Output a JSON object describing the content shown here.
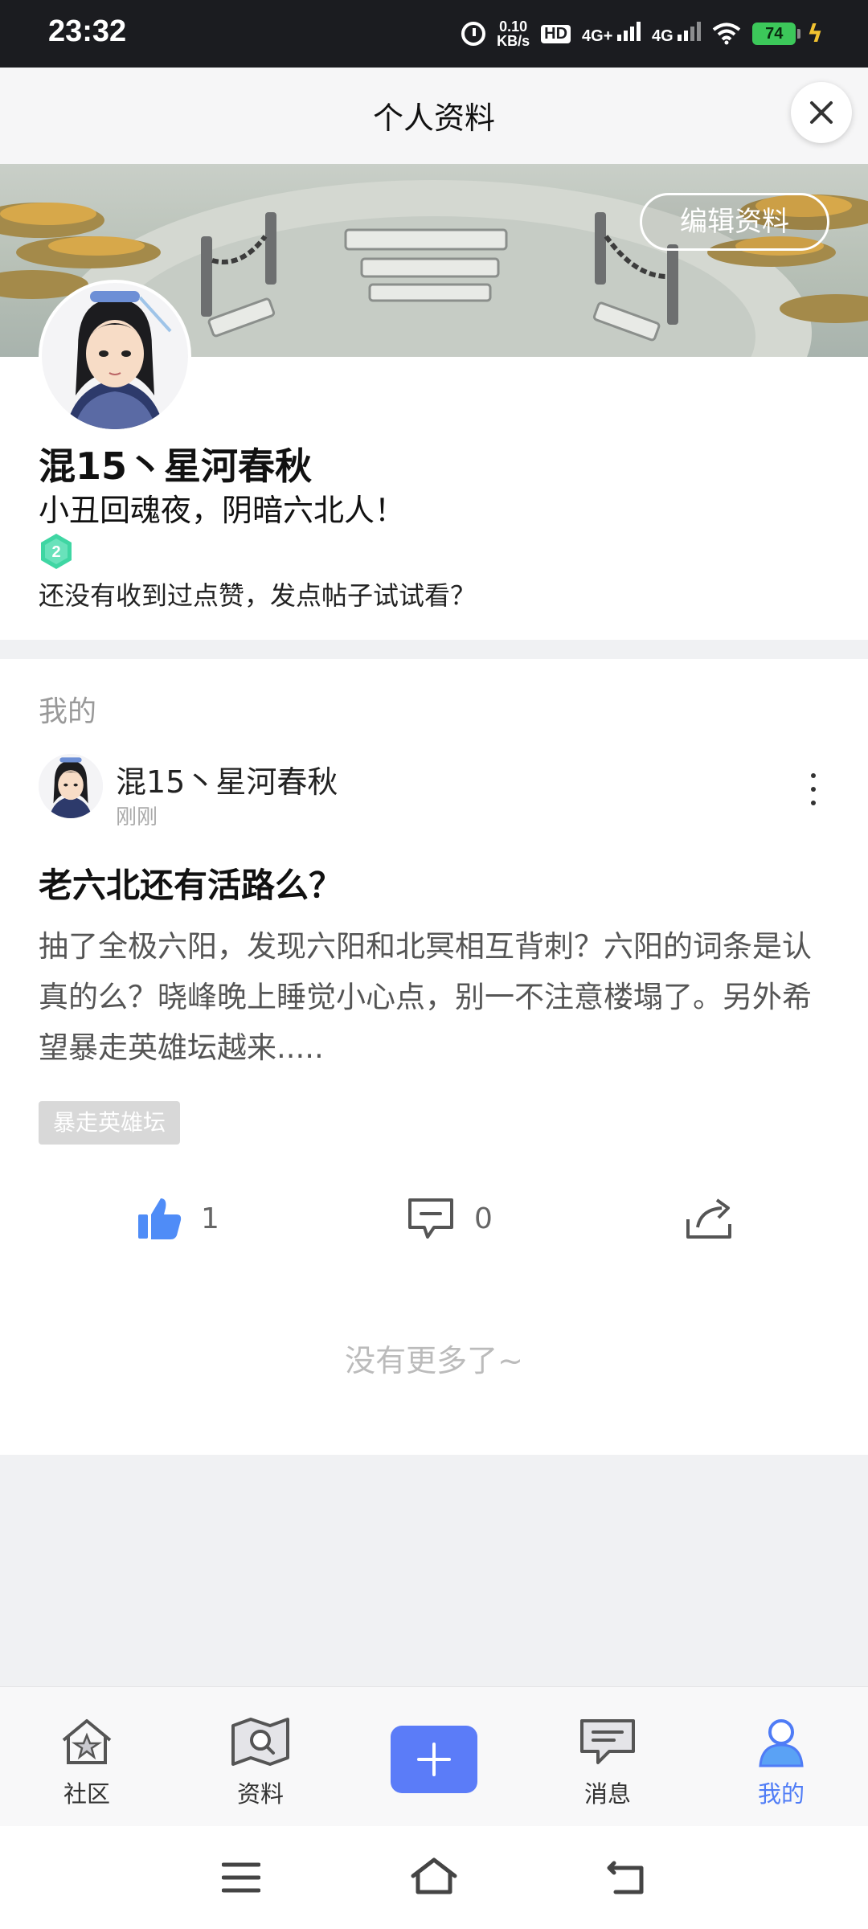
{
  "status_bar": {
    "time": "23:32",
    "net_speed_value": "0.10",
    "net_speed_unit": "KB/s",
    "hd_label": "HD",
    "signal1_label": "4G+",
    "signal2_label": "4G",
    "battery_level": "74"
  },
  "header": {
    "title": "个人资料"
  },
  "banner": {
    "edit_label": "编辑资料"
  },
  "profile": {
    "nickname": "混15丶星河春秋",
    "signature": "小丑回魂夜，阴暗六北人！",
    "level": "2",
    "no_likes_text": "还没有收到过点赞，发点帖子试试看？"
  },
  "section": {
    "label": "我的",
    "post": {
      "author": "混15丶星河春秋",
      "time": "刚刚",
      "title": "老六北还有活路么？",
      "body": "抽了全极六阳，发现六阳和北冥相互背刺？六阳的词条是认真的么？晓峰晚上睡觉小心点，别一不注意楼塌了。另外希望暴走英雄坛越来.....",
      "tag": "暴走英雄坛",
      "likes": "1",
      "comments": "0"
    },
    "no_more": "没有更多了~"
  },
  "bottom_nav": {
    "items": [
      {
        "label": "社区",
        "icon": "community-icon"
      },
      {
        "label": "资料",
        "icon": "wiki-icon"
      },
      {
        "label": "消息",
        "icon": "message-icon"
      },
      {
        "label": "我的",
        "icon": "profile-icon"
      }
    ],
    "active_index": 3
  },
  "colors": {
    "accent": "#5b7cf8",
    "active_nav": "#4f7cf6",
    "like_blue": "#4f8cf7",
    "level_green": "#3fd6a3"
  }
}
